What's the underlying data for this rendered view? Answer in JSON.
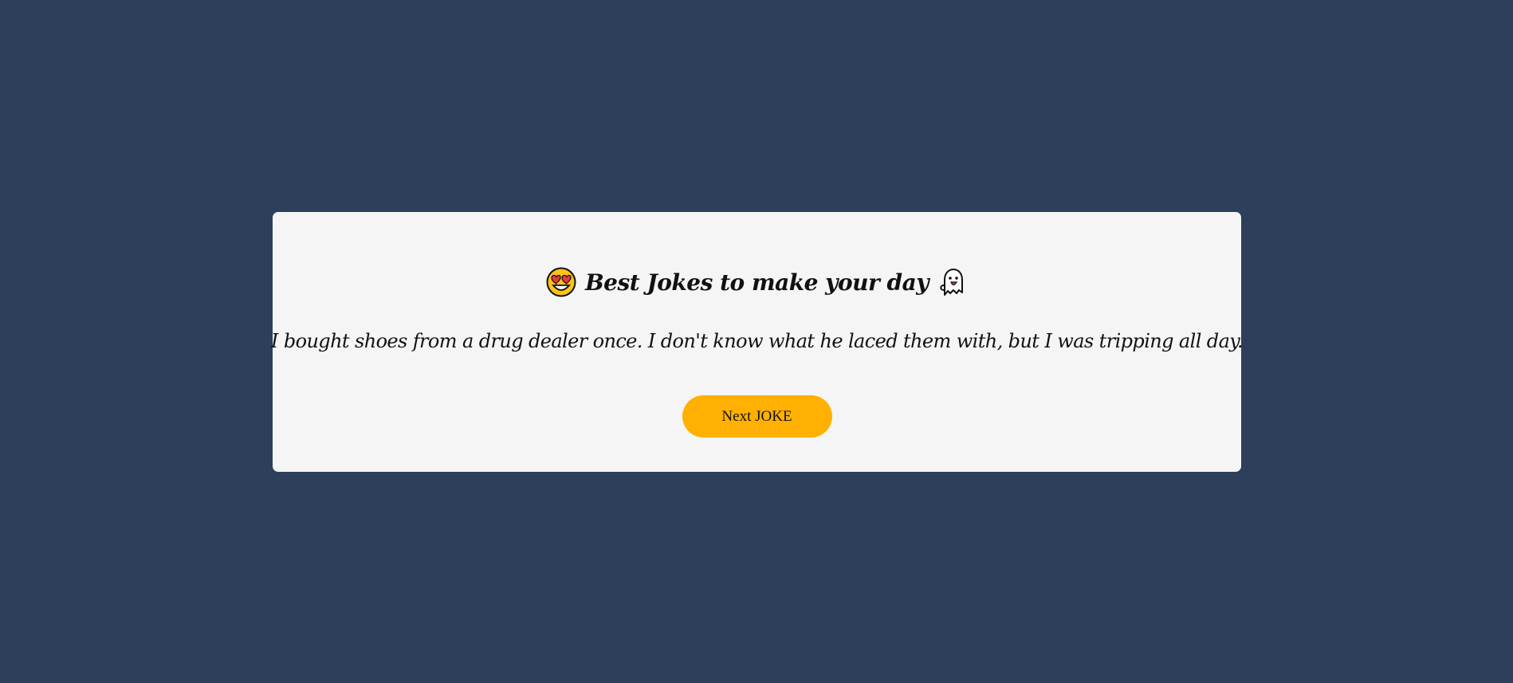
{
  "header": {
    "title": "Best Jokes to make your day",
    "left_icon": "heart-eyes-smiley-icon",
    "right_icon": "ghost-icon"
  },
  "joke": {
    "text": "I bought shoes from a drug dealer once. I don't know what he laced them with, but I was tripping all day."
  },
  "actions": {
    "next_label": "Next JOKE"
  },
  "colors": {
    "background": "#2d3f5a",
    "card": "#f5f5f5",
    "button": "#ffb000",
    "text": "#111111"
  }
}
